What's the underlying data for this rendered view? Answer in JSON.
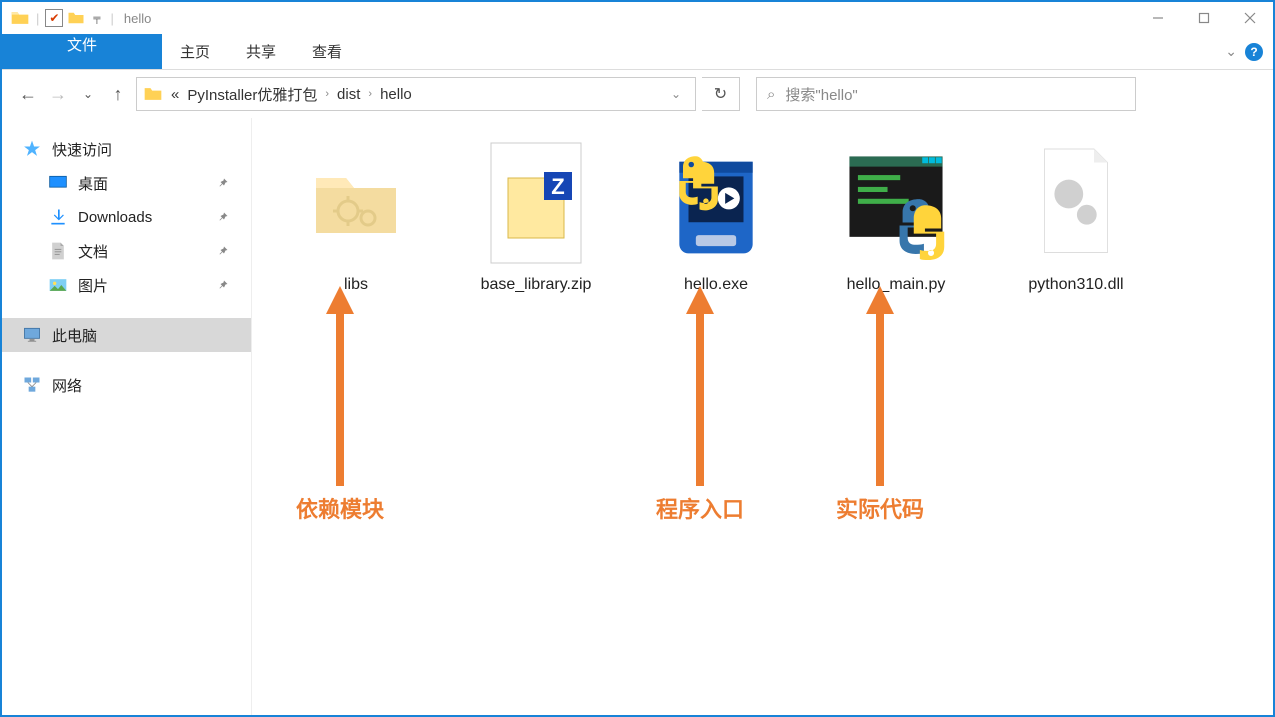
{
  "window": {
    "title": "hello"
  },
  "ribbon": {
    "file": "文件",
    "tabs": [
      "主页",
      "共享",
      "查看"
    ]
  },
  "breadcrumb": {
    "prefix": "«",
    "segments": [
      "PyInstaller优雅打包",
      "dist",
      "hello"
    ]
  },
  "search": {
    "placeholder": "搜索\"hello\""
  },
  "sidebar": {
    "quick_access": "快速访问",
    "items": [
      {
        "label": "桌面",
        "icon": "desktop"
      },
      {
        "label": "Downloads",
        "icon": "downloads"
      },
      {
        "label": "文档",
        "icon": "documents"
      },
      {
        "label": "图片",
        "icon": "pictures"
      }
    ],
    "this_pc": "此电脑",
    "network": "网络"
  },
  "files": [
    {
      "name": "libs",
      "type": "folder"
    },
    {
      "name": "base_library.zip",
      "type": "zip"
    },
    {
      "name": "hello.exe",
      "type": "exe"
    },
    {
      "name": "hello_main.py",
      "type": "python"
    },
    {
      "name": "python310.dll",
      "type": "dll"
    }
  ],
  "annotations": [
    {
      "label": "依赖模块",
      "target": 0
    },
    {
      "label": "程序入口",
      "target": 2
    },
    {
      "label": "实际代码",
      "target": 3
    }
  ]
}
